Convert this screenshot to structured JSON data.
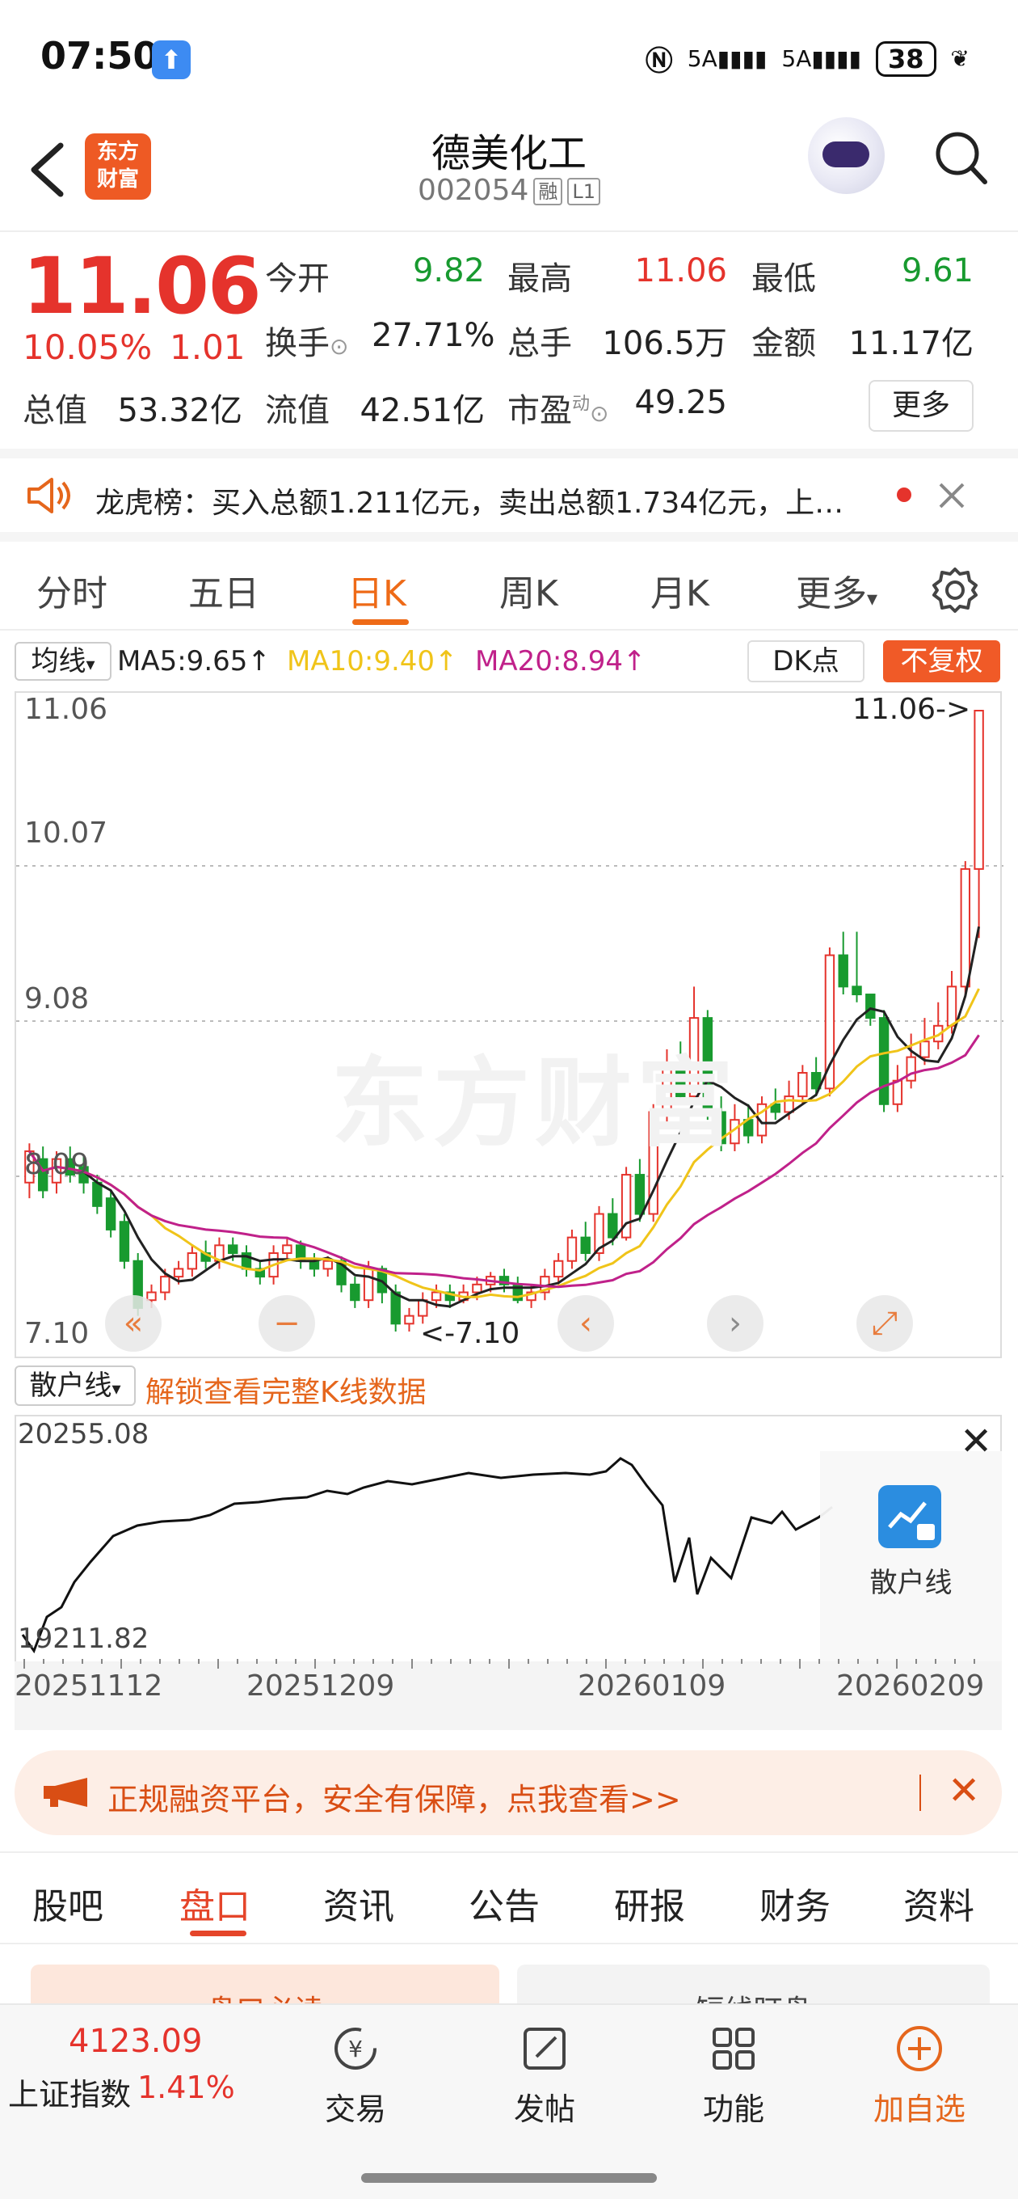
{
  "status_bar": {
    "time": "07:50",
    "signal1": "5A",
    "signal2": "5A",
    "battery": "38"
  },
  "header": {
    "name": "德美化工",
    "code": "002054",
    "tag1": "融",
    "tag2": "L1",
    "logo_line1": "东方",
    "logo_line2": "财富"
  },
  "quote": {
    "price": "11.06",
    "change_pct": "10.05%",
    "change": "1.01",
    "open_label": "今开",
    "open": "9.82",
    "high_label": "最高",
    "high": "11.06",
    "low_label": "最低",
    "low": "9.61",
    "turnover_label": "换手",
    "turnover": "27.71%",
    "volume_label": "总手",
    "volume": "106.5万",
    "amount_label": "金额",
    "amount": "11.17亿",
    "mcap_label": "总值",
    "mcap": "53.32亿",
    "float_label": "流值",
    "float": "42.51亿",
    "pe_label": "市盈",
    "pe_sup": "动",
    "pe": "49.25",
    "more": "更多"
  },
  "notice": {
    "text": "龙虎榜：买入总额1.211亿元，卖出总额1.734亿元，上…"
  },
  "period_tabs": [
    "分时",
    "五日",
    "日K",
    "周K",
    "月K",
    "更多"
  ],
  "ma": {
    "select": "均线",
    "ma5": "MA5:9.65",
    "ma10": "MA10:9.40",
    "ma20": "MA20:8.94",
    "dk": "DK点",
    "adjust": "不复权"
  },
  "kline": {
    "y_labels": [
      "11.06",
      "10.07",
      "9.08",
      "8.09",
      "7.10"
    ],
    "high_marker": "11.06->",
    "low_marker": "<-7.10",
    "watermark": "东方财富"
  },
  "retail": {
    "select": "散户线",
    "unlock": "解锁查看完整K线数据",
    "top": "20255.08",
    "bottom": "19211.82",
    "panel_label": "散户线",
    "dates": [
      "20251112",
      "20251209",
      "20260109",
      "20260209"
    ]
  },
  "promo": {
    "text": "正规融资平台，安全有保障，点我查看>>"
  },
  "info_tabs": [
    "股吧",
    "盘口",
    "资讯",
    "公告",
    "研报",
    "财务",
    "资料"
  ],
  "sub_tabs": {
    "left": "盘口必读",
    "right": "短线盯盘"
  },
  "bottom": {
    "index_value": "4123.09",
    "index_name": "上证指数",
    "index_pct": "1.41%",
    "trade": "交易",
    "post": "发帖",
    "func": "功能",
    "add": "加自选"
  },
  "colors": {
    "up": "#e5332c",
    "down": "#189a2f",
    "accent": "#ee6a17",
    "ma5": "#222222",
    "ma10": "#f0c419",
    "ma20": "#c0218a"
  },
  "chart_data": {
    "type": "candlestick",
    "ylim": [
      7.1,
      11.06
    ],
    "candles": [
      [
        8.05,
        8.25,
        8.3,
        7.95
      ],
      [
        8.2,
        8.0,
        8.28,
        7.95
      ],
      [
        8.05,
        8.2,
        8.25,
        7.98
      ],
      [
        8.2,
        8.1,
        8.28,
        8.05
      ],
      [
        8.15,
        8.05,
        8.22,
        7.98
      ],
      [
        8.05,
        7.9,
        8.1,
        7.85
      ],
      [
        7.95,
        7.75,
        8.0,
        7.7
      ],
      [
        7.8,
        7.55,
        7.85,
        7.5
      ],
      [
        7.55,
        7.25,
        7.6,
        7.2
      ],
      [
        7.3,
        7.35,
        7.4,
        7.25
      ],
      [
        7.35,
        7.45,
        7.5,
        7.3
      ],
      [
        7.45,
        7.5,
        7.55,
        7.4
      ],
      [
        7.5,
        7.6,
        7.65,
        7.45
      ],
      [
        7.6,
        7.55,
        7.68,
        7.5
      ],
      [
        7.55,
        7.65,
        7.7,
        7.5
      ],
      [
        7.65,
        7.6,
        7.7,
        7.55
      ],
      [
        7.6,
        7.5,
        7.65,
        7.45
      ],
      [
        7.5,
        7.45,
        7.55,
        7.4
      ],
      [
        7.45,
        7.6,
        7.65,
        7.4
      ],
      [
        7.6,
        7.65,
        7.7,
        7.55
      ],
      [
        7.65,
        7.55,
        7.68,
        7.5
      ],
      [
        7.55,
        7.5,
        7.6,
        7.45
      ],
      [
        7.5,
        7.55,
        7.58,
        7.45
      ],
      [
        7.55,
        7.4,
        7.58,
        7.35
      ],
      [
        7.4,
        7.3,
        7.45,
        7.25
      ],
      [
        7.3,
        7.5,
        7.55,
        7.25
      ],
      [
        7.5,
        7.35,
        7.52,
        7.28
      ],
      [
        7.35,
        7.15,
        7.4,
        7.1
      ],
      [
        7.15,
        7.2,
        7.25,
        7.1
      ],
      [
        7.2,
        7.3,
        7.35,
        7.15
      ],
      [
        7.3,
        7.35,
        7.4,
        7.25
      ],
      [
        7.35,
        7.3,
        7.4,
        7.25
      ],
      [
        7.3,
        7.35,
        7.4,
        7.28
      ],
      [
        7.35,
        7.4,
        7.45,
        7.3
      ],
      [
        7.4,
        7.45,
        7.48,
        7.35
      ],
      [
        7.45,
        7.4,
        7.5,
        7.35
      ],
      [
        7.4,
        7.3,
        7.45,
        7.28
      ],
      [
        7.3,
        7.35,
        7.4,
        7.25
      ],
      [
        7.35,
        7.45,
        7.5,
        7.3
      ],
      [
        7.45,
        7.55,
        7.6,
        7.4
      ],
      [
        7.55,
        7.7,
        7.75,
        7.5
      ],
      [
        7.7,
        7.6,
        7.8,
        7.55
      ],
      [
        7.6,
        7.85,
        7.9,
        7.55
      ],
      [
        7.85,
        7.7,
        7.95,
        7.65
      ],
      [
        7.7,
        8.1,
        8.15,
        7.68
      ],
      [
        8.1,
        7.85,
        8.2,
        7.8
      ],
      [
        7.85,
        8.5,
        8.55,
        7.8
      ],
      [
        8.5,
        8.8,
        8.9,
        8.4
      ],
      [
        8.8,
        8.6,
        8.95,
        8.55
      ],
      [
        8.6,
        9.1,
        9.3,
        8.55
      ],
      [
        9.1,
        8.5,
        9.15,
        8.45
      ],
      [
        8.5,
        8.3,
        8.6,
        8.25
      ],
      [
        8.3,
        8.45,
        8.55,
        8.25
      ],
      [
        8.45,
        8.35,
        8.55,
        8.3
      ],
      [
        8.35,
        8.55,
        8.6,
        8.3
      ],
      [
        8.55,
        8.5,
        8.65,
        8.45
      ],
      [
        8.5,
        8.6,
        8.7,
        8.45
      ],
      [
        8.6,
        8.75,
        8.8,
        8.55
      ],
      [
        8.75,
        8.65,
        8.85,
        8.6
      ],
      [
        8.65,
        9.5,
        9.55,
        8.6
      ],
      [
        9.5,
        9.3,
        9.65,
        9.25
      ],
      [
        9.3,
        9.25,
        9.65,
        9.2
      ],
      [
        9.25,
        9.1,
        9.2,
        9.05
      ],
      [
        9.1,
        8.55,
        9.15,
        8.5
      ],
      [
        8.55,
        8.7,
        8.8,
        8.5
      ],
      [
        8.7,
        8.85,
        9.0,
        8.65
      ],
      [
        8.85,
        8.95,
        9.1,
        8.8
      ],
      [
        8.95,
        9.05,
        9.2,
        8.9
      ],
      [
        9.05,
        9.3,
        9.4,
        9.0
      ],
      [
        9.3,
        10.05,
        10.1,
        9.25
      ],
      [
        10.05,
        11.06,
        11.06,
        9.61
      ]
    ]
  }
}
